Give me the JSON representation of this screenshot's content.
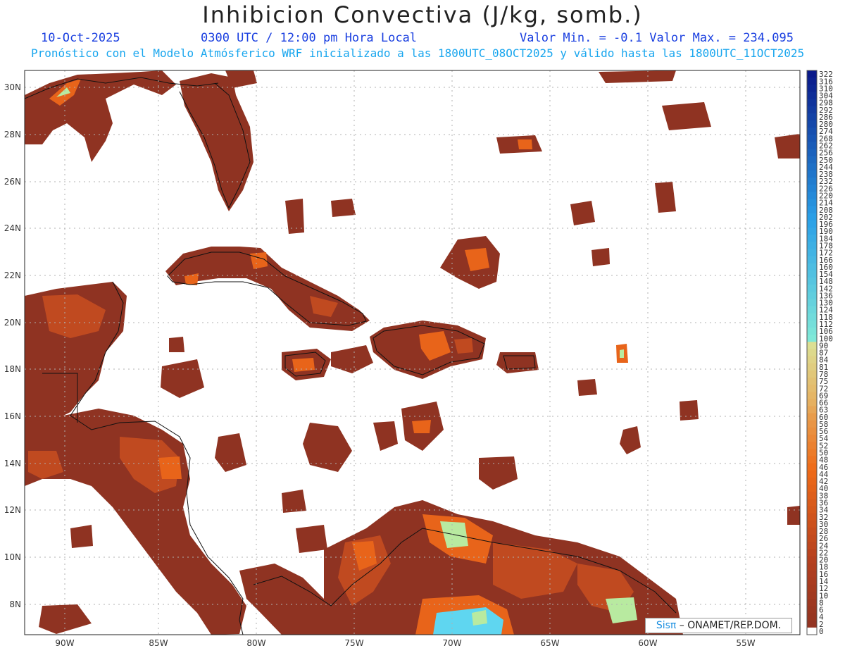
{
  "header": {
    "title": "Inhibicion Convectiva (J/kg, somb.)",
    "date": "10-Oct-2025",
    "time": "0300 UTC / 12:00 pm Hora Local",
    "minmax": "Valor Min. = -0.1  Valor Max. = 234.095",
    "model_line": "Pronóstico con el Modelo Atmósferico WRF inicializado a las 1800UTC_08OCT2025 y válido hasta las  1800UTC_11OCT2025"
  },
  "map": {
    "lon_ticks": [
      "90W",
      "85W",
      "80W",
      "75W",
      "70W",
      "65W",
      "60W",
      "55W"
    ],
    "lat_ticks": [
      "30N",
      "28N",
      "26N",
      "24N",
      "22N",
      "20N",
      "18N",
      "16N",
      "14N",
      "12N",
      "10N",
      "8N"
    ],
    "colors": {
      "field_dark": "#8f3322",
      "field_mid": "#c04a20",
      "field_hot": "#e8641a",
      "field_green": "#b8eaa0",
      "field_cyan": "#5fd6f0",
      "coast": "#111111",
      "grid": "#b0b0b0"
    }
  },
  "colorbar": {
    "labels": [
      "322",
      "316",
      "310",
      "304",
      "298",
      "292",
      "286",
      "280",
      "274",
      "268",
      "262",
      "256",
      "250",
      "244",
      "238",
      "232",
      "226",
      "220",
      "214",
      "208",
      "202",
      "196",
      "190",
      "184",
      "178",
      "172",
      "166",
      "160",
      "154",
      "148",
      "142",
      "136",
      "130",
      "124",
      "118",
      "112",
      "106",
      "100",
      "90",
      "87",
      "84",
      "81",
      "78",
      "75",
      "72",
      "69",
      "66",
      "63",
      "60",
      "58",
      "56",
      "54",
      "52",
      "50",
      "48",
      "46",
      "44",
      "42",
      "40",
      "38",
      "36",
      "34",
      "32",
      "30",
      "28",
      "26",
      "24",
      "22",
      "20",
      "18",
      "16",
      "14",
      "12",
      "10",
      "8",
      "6",
      "4",
      "2",
      "0"
    ]
  },
  "credit": {
    "sis": "Sisπ",
    "text": " – ONAMET/REP.DOM."
  }
}
